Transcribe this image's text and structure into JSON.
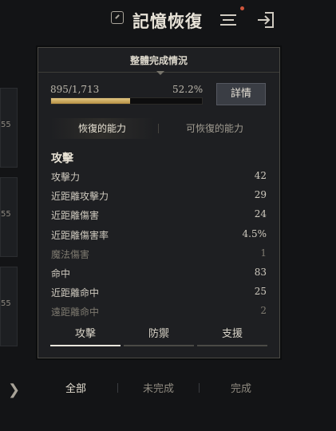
{
  "header": {
    "title": "記憶恢復"
  },
  "background": {
    "thumb_levels": [
      "55",
      "55",
      "55"
    ],
    "tabs": [
      "全部",
      "未完成",
      "完成"
    ],
    "active_tab": 0
  },
  "panel": {
    "title": "整體完成情況",
    "progress_text": "895/1,713",
    "percent_text": "52.2%",
    "progress_value": 0.522,
    "detail_button": "詳情",
    "subtabs": [
      "恢復的能力",
      "可恢復的能力"
    ],
    "section_title": "攻擊",
    "stats": [
      {
        "label": "攻擊力",
        "value": "42",
        "dim": false
      },
      {
        "label": "近距離攻擊力",
        "value": "29",
        "dim": false
      },
      {
        "label": "近距離傷害",
        "value": "24",
        "dim": false
      },
      {
        "label": "近距離傷害率",
        "value": "4.5%",
        "dim": false
      },
      {
        "label": "魔法傷害",
        "value": "1",
        "dim": true
      },
      {
        "label": "命中",
        "value": "83",
        "dim": false
      },
      {
        "label": "近距離命中",
        "value": "25",
        "dim": false
      },
      {
        "label": "遠距離命中",
        "value": "2",
        "dim": true
      }
    ],
    "tabs": [
      "攻擊",
      "防禦",
      "支援"
    ],
    "active_tab": 0
  },
  "colors": {
    "accent_gold": "#d6b46a",
    "panel_bg": "#1e1f22",
    "notification": "#d0563c"
  }
}
